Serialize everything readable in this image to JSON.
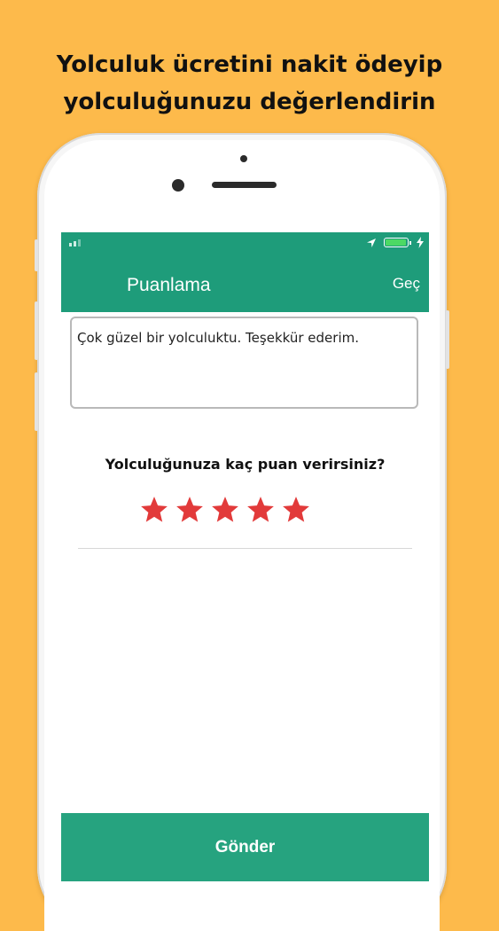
{
  "headline": {
    "line1": "Yolculuk ücretini nakit ödeyip",
    "line2": "yolculuğunuzu değerlendirin"
  },
  "colors": {
    "background": "#FDBA4B",
    "primary": "#1E9C7A",
    "button": "#26A37F",
    "star": "#E23A3A"
  },
  "status_bar": {
    "icons": [
      "signal-icon",
      "location-arrow-icon",
      "battery-icon",
      "charging-bolt-icon"
    ],
    "battery_level": 1.0
  },
  "app_bar": {
    "title": "Puanlama",
    "skip_label": "Geç"
  },
  "comment": {
    "value": "Çok güzel bir yolculuktu. Teşekkür ederim."
  },
  "rating": {
    "question": "Yolculuğunuza kaç puan verirsiniz?",
    "value": 5,
    "max": 5
  },
  "submit": {
    "label": "Gönder"
  }
}
